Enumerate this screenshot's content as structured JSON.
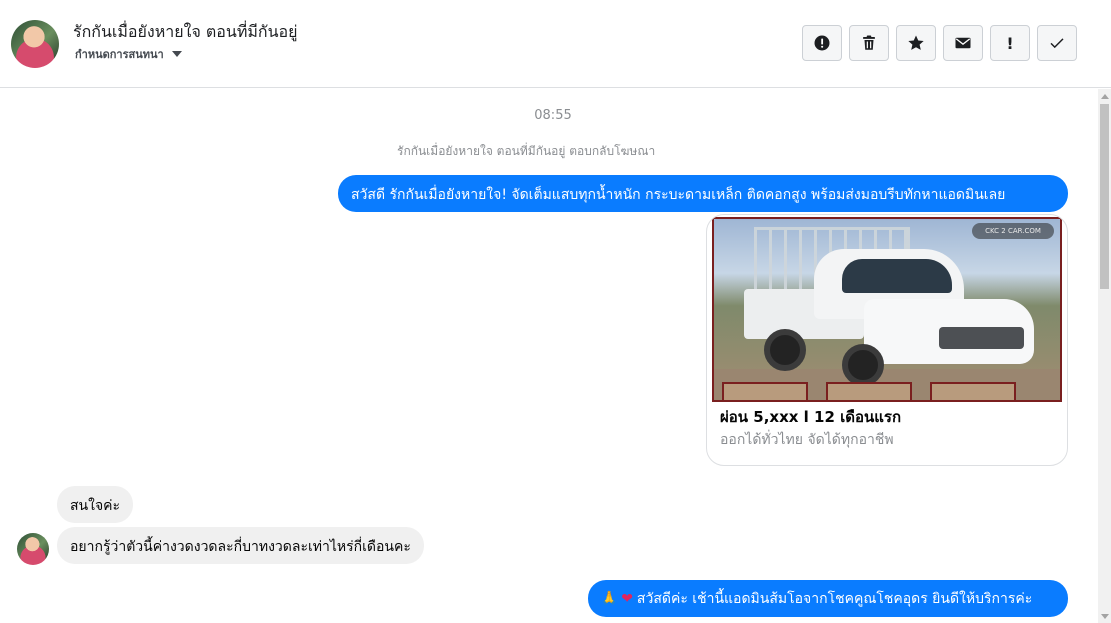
{
  "header": {
    "title": "รักกันเมื่อยังหายใจ ตอนที่มีกันอยู่",
    "subtitle": "กำหนดการสนทนา",
    "actions": [
      {
        "name": "report-button",
        "icon": "alert-circle-icon"
      },
      {
        "name": "delete-button",
        "icon": "trash-icon"
      },
      {
        "name": "star-button",
        "icon": "star-icon"
      },
      {
        "name": "mark-unread-button",
        "icon": "envelope-icon"
      },
      {
        "name": "flag-important-button",
        "label": "!"
      },
      {
        "name": "mark-done-button",
        "icon": "check-icon"
      }
    ]
  },
  "conversation": {
    "timestamp": "08:55",
    "system_message": "รักกันเมื่อยังหายใจ ตอนที่มีกันอยู่ ตอบกลับโฆษณา",
    "outgoing_1": "สวัสดี รักกันเมื่อยังหายใจ! จัดเต็มแสบทุกน้ำหนัก กระบะดามเหล็ก ติดคอกสูง พร้อมส่งมอบรีบทักหาแอดมินเลย",
    "card": {
      "title": "ผ่อน 5,xxx l 12 เดือนแรก",
      "subtitle": "ออกได้ทั่วไทย จัดได้ทุกอาชีพ",
      "watermark": "CKC 2 CAR.COM"
    },
    "incoming_1": "สนใจค่ะ",
    "incoming_2": "อยากรู้ว่าตัวนี้ค่างวดงวดละกี่บาทงวดละเท่าไหร่กี่เดือนคะ",
    "outgoing_2": "สวัสดีค่ะ เช้านี้แอดมินส้มโอจากโชคคูณโชคอุดร ยินดีให้บริการค่ะ",
    "outgoing_2_emojis": [
      "🙏",
      "❤"
    ]
  },
  "colors": {
    "accent": "#0a7cff",
    "incoming_bubble": "#f0f0f0",
    "muted_text": "#8a8d91"
  }
}
